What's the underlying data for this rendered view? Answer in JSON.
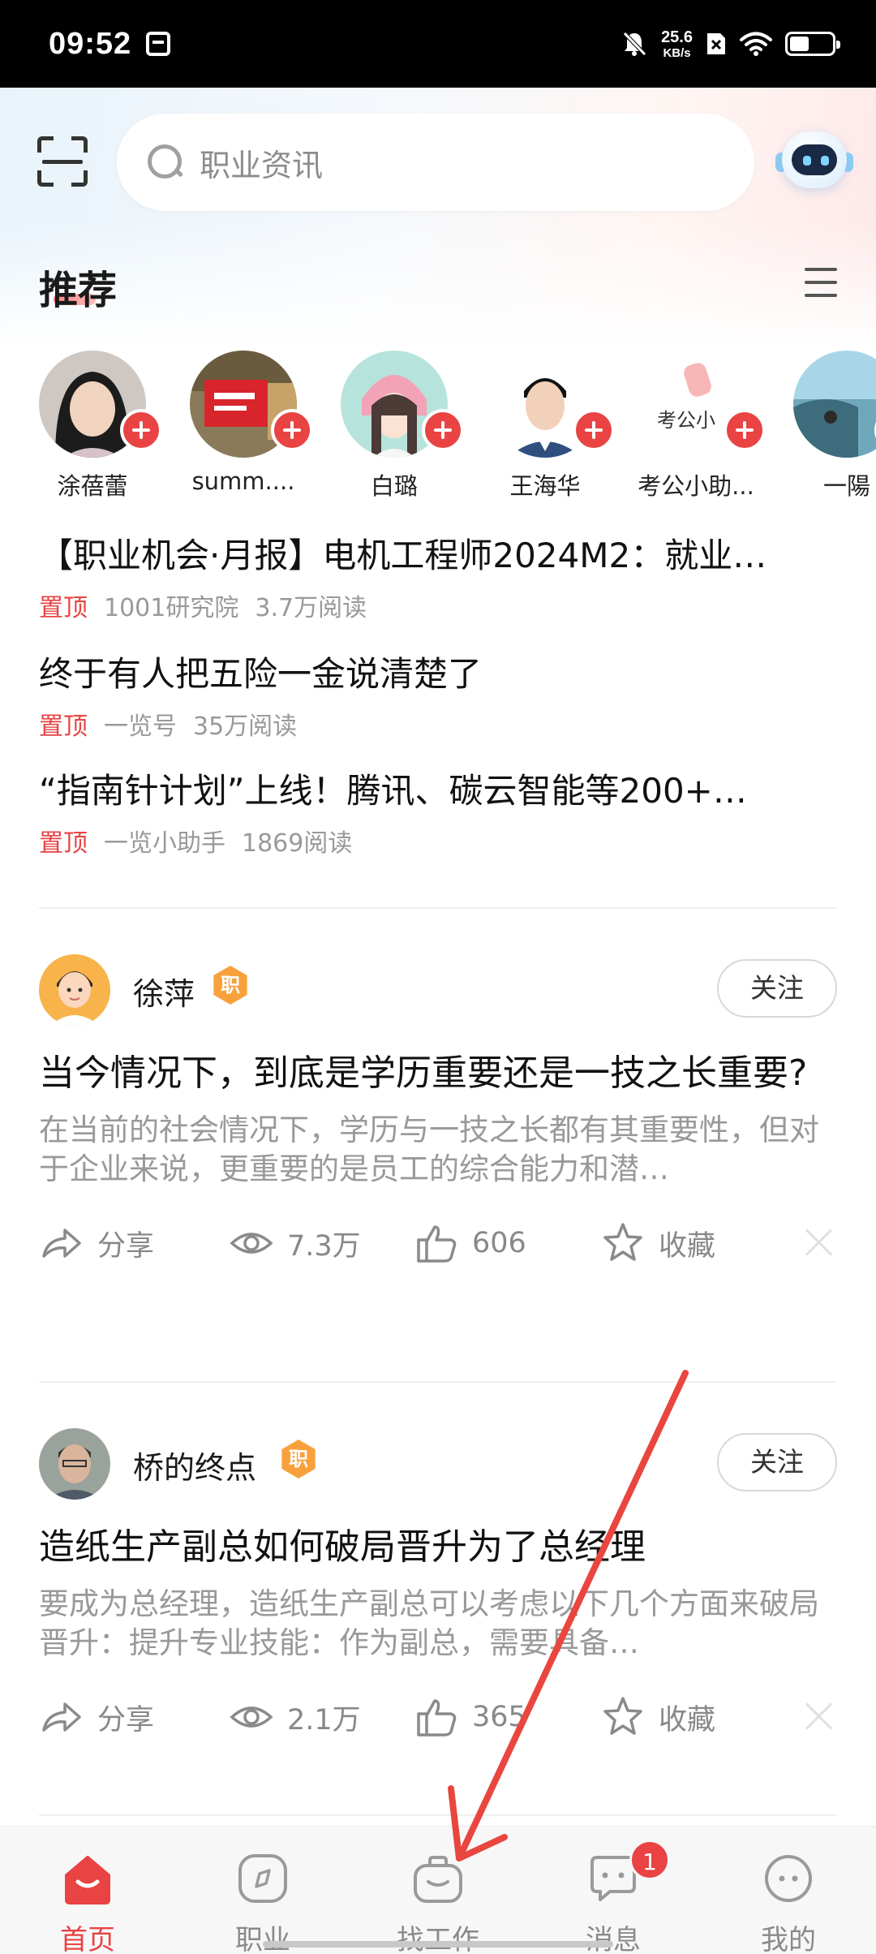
{
  "status_bar": {
    "time": "09:52",
    "net_speed_value": "25.6",
    "net_speed_unit": "KB/s",
    "battery_level": 0.45,
    "icons": [
      "app-notification-icon",
      "mute-bell-icon",
      "sim-x-icon",
      "wifi-icon",
      "battery-icon"
    ]
  },
  "header": {
    "search_placeholder": "职业资讯",
    "icons": [
      "scan-icon",
      "search-icon",
      "robot-assistant-icon"
    ]
  },
  "recommend": {
    "title": "推荐",
    "authors": [
      {
        "name": "涂蓓蕾"
      },
      {
        "name": "summ...."
      },
      {
        "name": "白璐"
      },
      {
        "name": "王海华"
      },
      {
        "name": "考公小助...",
        "avatar_text": "考公小"
      },
      {
        "name": "一陽"
      }
    ]
  },
  "pinned": [
    {
      "title": "【职业机会·月报】电机工程师2024M2：就业…",
      "tag": "置顶",
      "source": "1001研究院",
      "reads": "3.7万阅读"
    },
    {
      "title": "终于有人把五险一金说清楚了",
      "tag": "置顶",
      "source": "一览号",
      "reads": "35万阅读"
    },
    {
      "title": "“指南针计划”上线！腾讯、碳云智能等200+…",
      "tag": "置顶",
      "source": "一览小助手",
      "reads": "1869阅读"
    }
  ],
  "posts": [
    {
      "author": "徐萍",
      "badge": "职",
      "follow_label": "关注",
      "title": "当今情况下，到底是学历重要还是一技之长重要?",
      "summary": "在当前的社会情况下，学历与一技之长都有其重要性，但对于企业来说，更重要的是员工的综合能力和潜…",
      "share_label": "分享",
      "views": "7.3万",
      "likes": "606",
      "collect_label": "收藏"
    },
    {
      "author": "桥的终点",
      "badge": "职",
      "follow_label": "关注",
      "title": "造纸生产副总如何破局晋升为了总经理",
      "summary": "要成为总经理，造纸生产副总可以考虑以下几个方面来破局晋升：提升专业技能：作为副总，需要具备…",
      "share_label": "分享",
      "views": "2.1万",
      "likes": "365",
      "collect_label": "收藏"
    }
  ],
  "bottom_nav": {
    "items": [
      {
        "label": "首页",
        "icon": "home-icon",
        "active": true
      },
      {
        "label": "职业",
        "icon": "compass-icon",
        "active": false
      },
      {
        "label": "找工作",
        "icon": "bag-icon",
        "active": false
      },
      {
        "label": "消息",
        "icon": "chat-icon",
        "active": false,
        "badge": "1"
      },
      {
        "label": "我的",
        "icon": "profile-icon",
        "active": false
      }
    ]
  },
  "colors": {
    "accent": "#e94343",
    "badge": "#f8a13c",
    "muted_text": "#999999",
    "arrow": "#e8463e"
  }
}
